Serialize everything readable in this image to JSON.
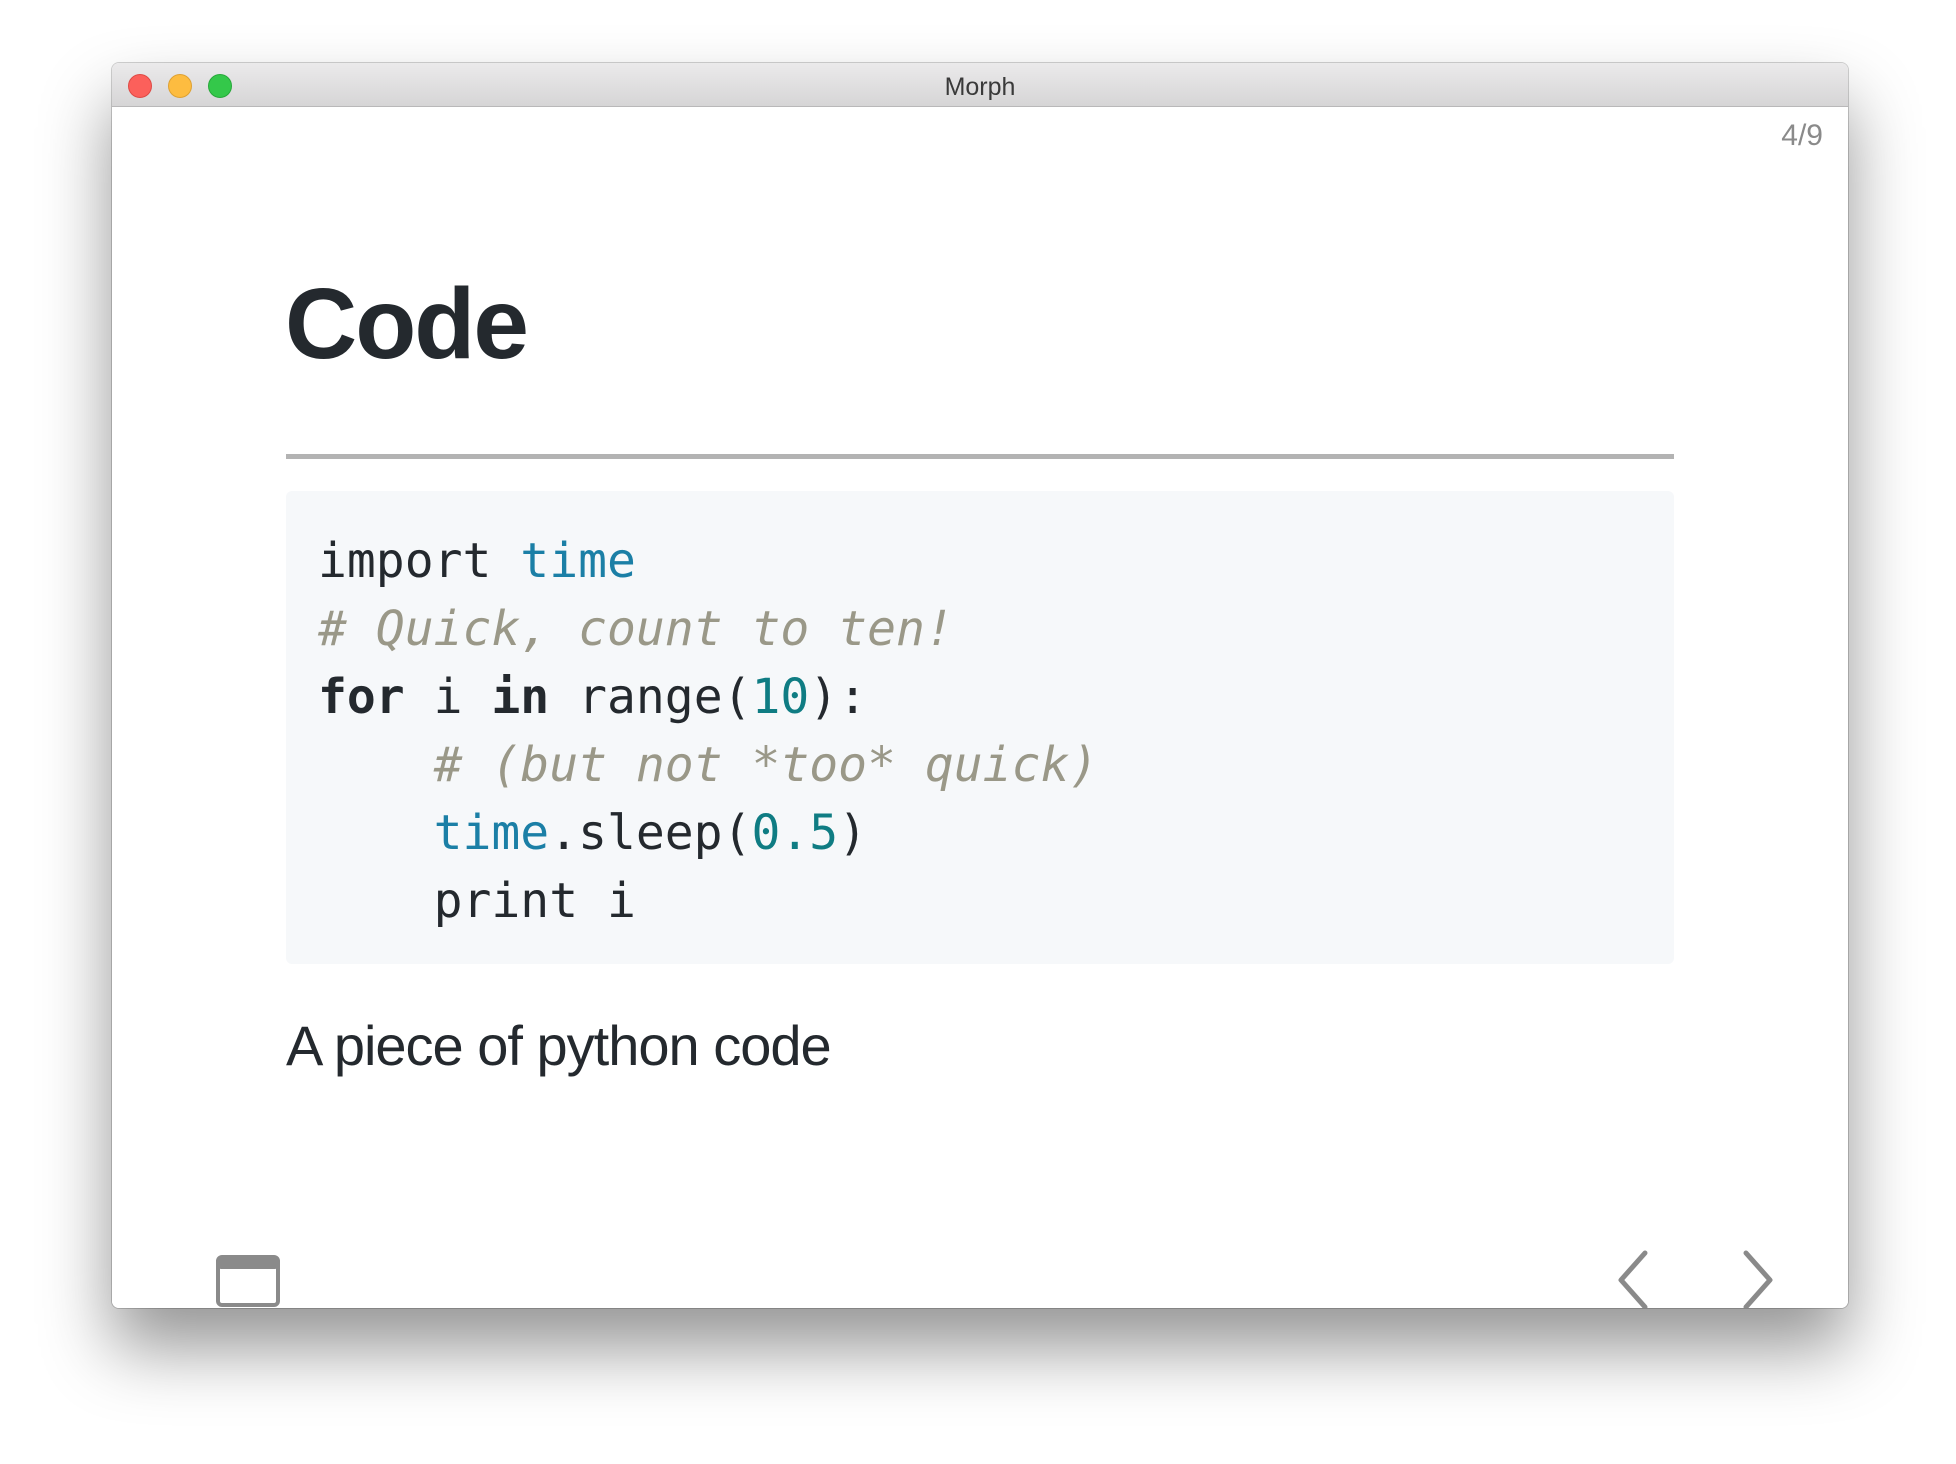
{
  "window": {
    "title": "Morph"
  },
  "slide": {
    "counter": "4/9",
    "title": "Code",
    "code": {
      "lines": [
        {
          "indent": "",
          "tokens": [
            {
              "cls": "plain",
              "text": "import "
            },
            {
              "cls": "mod",
              "text": "time"
            }
          ]
        },
        {
          "indent": "",
          "tokens": [
            {
              "cls": "cmt",
              "text": "# Quick, count to ten!"
            }
          ]
        },
        {
          "indent": "",
          "tokens": [
            {
              "cls": "kw",
              "text": "for"
            },
            {
              "cls": "plain",
              "text": " i "
            },
            {
              "cls": "kw",
              "text": "in"
            },
            {
              "cls": "plain",
              "text": " range("
            },
            {
              "cls": "num",
              "text": "10"
            },
            {
              "cls": "plain",
              "text": "):"
            }
          ]
        },
        {
          "indent": "    ",
          "tokens": [
            {
              "cls": "cmt",
              "text": "# (but not *too* quick)"
            }
          ]
        },
        {
          "indent": "    ",
          "tokens": [
            {
              "cls": "mod",
              "text": "time"
            },
            {
              "cls": "plain",
              "text": ".sleep("
            },
            {
              "cls": "num",
              "text": "0.5"
            },
            {
              "cls": "plain",
              "text": ")"
            }
          ]
        },
        {
          "indent": "    ",
          "tokens": [
            {
              "cls": "plain",
              "text": "print i"
            }
          ]
        }
      ]
    },
    "caption": "A piece of python code"
  },
  "controls": {
    "toggle_icon": "window-toggle-icon",
    "prev_icon": "chevron-left-icon",
    "next_icon": "chevron-right-icon",
    "icon_color": "#8a8a8a"
  },
  "colors": {
    "keyword": "#24292e",
    "module": "#1b7fa6",
    "number": "#0f7c83",
    "comment": "#9a9888",
    "code_background": "#f6f8fa"
  }
}
